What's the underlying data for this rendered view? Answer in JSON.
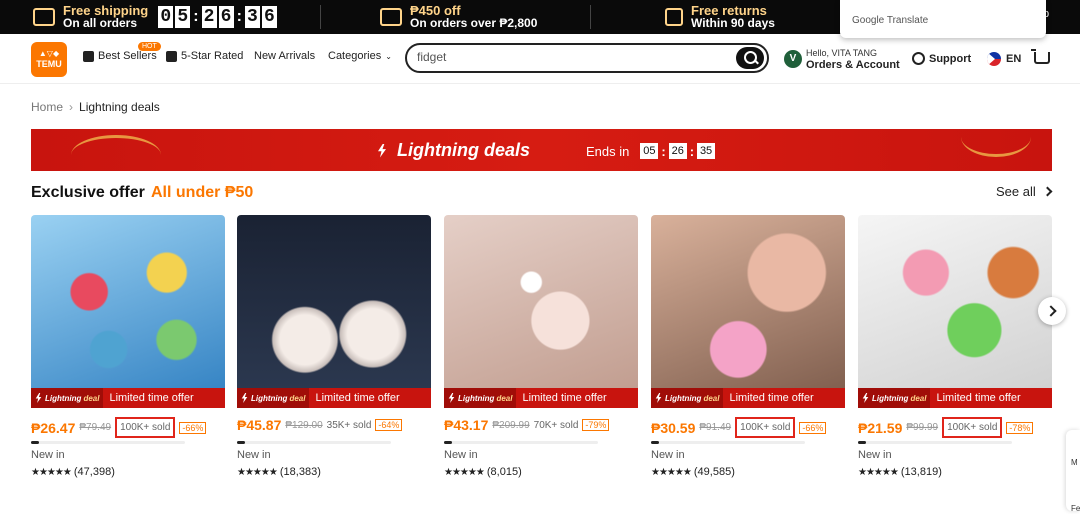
{
  "promo": {
    "shipping_title": "Free shipping",
    "shipping_sub": "On all orders",
    "timer_digits": [
      "0",
      "5",
      "2",
      "6",
      "3",
      "6"
    ],
    "offer_title": "₱450 off",
    "offer_sub": "On orders over ₱2,800",
    "returns_title": "Free returns",
    "returns_sub": "Within 90 days"
  },
  "google_translate": {
    "label": "Google Translate",
    "extra": "p"
  },
  "header": {
    "logo_text": "TEMU",
    "nav": [
      "Best Sellers",
      "5-Star Rated",
      "New Arrivals",
      "Categories"
    ],
    "hot_badge": "HOT",
    "search_value": "fidget",
    "avatar_letter": "V",
    "hello": "Hello, VITA TANG",
    "orders": "Orders & Account",
    "support": "Support",
    "language": "EN"
  },
  "breadcrumb": {
    "home": "Home",
    "current": "Lightning deals"
  },
  "banner": {
    "title": "Lightning deals",
    "ends_label": "Ends in",
    "hh": "05",
    "mm": "26",
    "ss": "35"
  },
  "section": {
    "title": "Exclusive offer",
    "subtitle": "All under ₱50",
    "see_all": "See all"
  },
  "deal_labels": {
    "lightning": "Lightning",
    "deal": "deal",
    "limited": "Limited time offer"
  },
  "products": [
    {
      "price": "₱26.47",
      "old_price": "₱79.49",
      "sold": "100K+ sold",
      "discount": "-66%",
      "new_in": "New in",
      "stars": "★★★★★",
      "reviews": "(47,398)",
      "sold_highlight": true,
      "progress": 0.05
    },
    {
      "price": "₱45.87",
      "old_price": "₱129.00",
      "sold": "35K+ sold",
      "discount": "-64%",
      "new_in": "New in",
      "stars": "★★★★★",
      "reviews": "(18,383)",
      "sold_highlight": false,
      "progress": 0.05
    },
    {
      "price": "₱43.17",
      "old_price": "₱209.99",
      "sold": "70K+ sold",
      "discount": "-79%",
      "new_in": "New in",
      "stars": "★★★★★",
      "reviews": "(8,015)",
      "sold_highlight": false,
      "progress": 0.05
    },
    {
      "price": "₱30.59",
      "old_price": "₱91.49",
      "sold": "100K+ sold",
      "discount": "-66%",
      "new_in": "New in",
      "stars": "★★★★★",
      "reviews": "(49,585)",
      "sold_highlight": true,
      "progress": 0.05
    },
    {
      "price": "₱21.59",
      "old_price": "₱99.99",
      "sold": "100K+ sold",
      "discount": "-78%",
      "new_in": "New in",
      "stars": "★★★★★",
      "reviews": "(13,819)",
      "sold_highlight": true,
      "progress": 0.05
    }
  ],
  "edge_tab": {
    "line1": "M",
    "line2": "Fe"
  },
  "colors": {
    "accent": "#fb7701",
    "banner_red": "#c8140e",
    "highlight_box": "#e0251b"
  }
}
